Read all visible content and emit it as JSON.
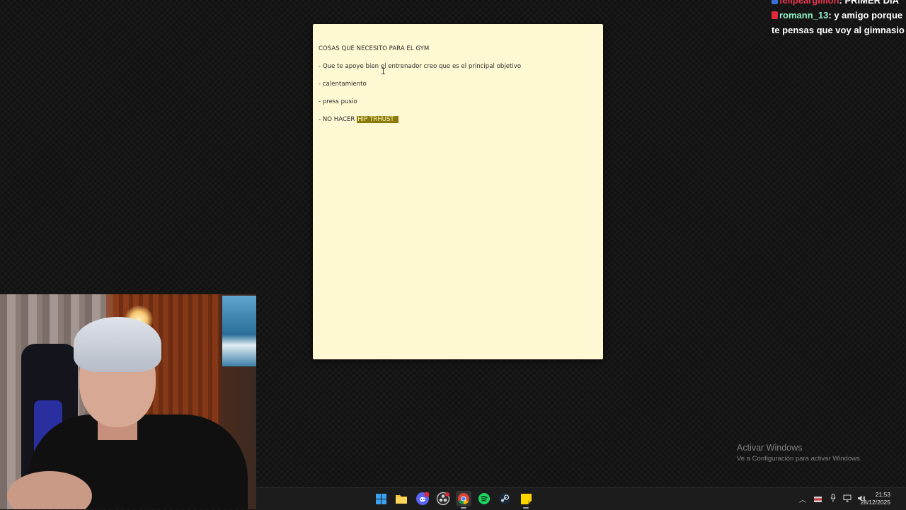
{
  "note": {
    "lines": [
      "COSAS QUE NECESITO PARA EL GYM",
      "- Que te apoye bien el entrenador creo que es el principal objetivo",
      "- calentamiento",
      "- press pusio",
      "- NO HACER "
    ],
    "highlighted": "HIP TRHUST",
    "colors": {
      "background": "#fff9d3",
      "highlight": "#8b7a0b"
    }
  },
  "chat": {
    "messages": [
      {
        "user": "felipeargillion",
        "user_color": "#e8364f",
        "badge_color": "#3a6fd8",
        "separator": ":",
        "text": " PRIMER DÍA"
      },
      {
        "user": "romann_13",
        "user_color": "#8ef0c9",
        "badge_color": "#e0283c",
        "separator": ":",
        "text": "  y amigo porque te pensas que voy al gimnasio"
      }
    ]
  },
  "watermark": {
    "title": "Activar Windows",
    "subtitle": "Ve a Configuración para activar Windows."
  },
  "taskbar": {
    "icons": [
      "windows-start-icon",
      "file-explorer-icon",
      "discord-icon",
      "obs-icon",
      "chrome-icon",
      "spotify-icon",
      "steam-icon",
      "sticky-notes-icon"
    ],
    "tray_icons": [
      "chevron-up-icon",
      "flag-icon",
      "microphone-icon",
      "network-icon",
      "volume-icon"
    ],
    "time": "21:53",
    "date": "28/12/2025"
  }
}
